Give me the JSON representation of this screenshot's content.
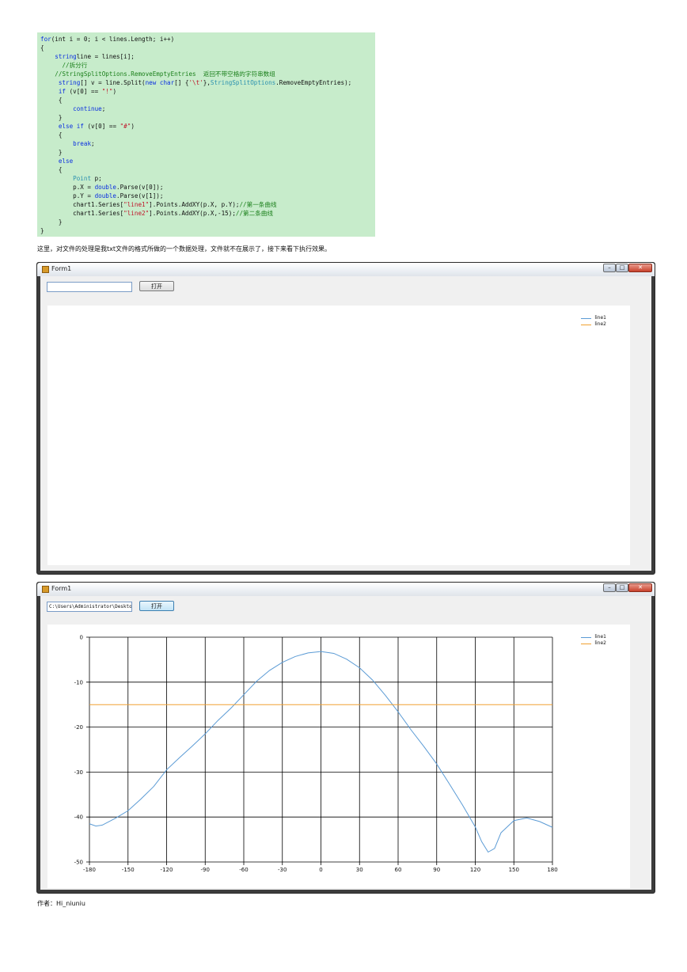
{
  "code": {
    "lines": [
      [
        [
          "kw",
          "for"
        ],
        [
          "",
          "(int i = 0; i < lines.Length; i++)"
        ]
      ],
      [
        [
          "",
          "{"
        ]
      ],
      [
        [
          "",
          "    "
        ],
        [
          "kw",
          "string"
        ],
        [
          "",
          "line = lines[i];"
        ]
      ],
      [
        [
          "",
          "      "
        ],
        [
          "cm",
          "//拆分行"
        ]
      ],
      [
        [
          "",
          "    "
        ],
        [
          "cm",
          "//StringSplitOptions.RemoveEmptyEntries  返回不带空格的字符串数组"
        ]
      ],
      [
        [
          "",
          "     "
        ],
        [
          "kw",
          "string"
        ],
        [
          "",
          "[] v = line.Split("
        ],
        [
          "kw",
          "new char"
        ],
        [
          "",
          "[] {"
        ],
        [
          "st",
          "'\\t'"
        ],
        [
          "",
          "},"
        ],
        [
          "ty",
          "StringSplitOptions"
        ],
        [
          "",
          ".RemoveEmptyEntries);"
        ]
      ],
      [
        [
          "",
          "     "
        ],
        [
          "kw",
          "if"
        ],
        [
          "",
          " (v[0] == "
        ],
        [
          "st",
          "\"!\""
        ],
        [
          "",
          ")"
        ]
      ],
      [
        [
          "",
          "     {"
        ]
      ],
      [
        [
          "",
          "         "
        ],
        [
          "kw",
          "continue"
        ],
        [
          "",
          ";"
        ]
      ],
      [
        [
          "",
          "     }"
        ]
      ],
      [
        [
          "",
          "     "
        ],
        [
          "kw",
          "else if"
        ],
        [
          "",
          " (v[0] == "
        ],
        [
          "st",
          "\"#\""
        ],
        [
          "",
          ")"
        ]
      ],
      [
        [
          "",
          "     {"
        ]
      ],
      [
        [
          "",
          "         "
        ],
        [
          "kw",
          "break"
        ],
        [
          "",
          ";"
        ]
      ],
      [
        [
          "",
          "     }"
        ]
      ],
      [
        [
          "",
          "     "
        ],
        [
          "kw",
          "else"
        ]
      ],
      [
        [
          "",
          "     {"
        ]
      ],
      [
        [
          "",
          "         "
        ],
        [
          "ty",
          "Point"
        ],
        [
          "",
          " p;"
        ]
      ],
      [
        [
          "",
          "         p.X = "
        ],
        [
          "kw",
          "double"
        ],
        [
          "",
          ".Parse(v[0]);"
        ]
      ],
      [
        [
          "",
          "         p.Y = "
        ],
        [
          "kw",
          "double"
        ],
        [
          "",
          ".Parse(v[1]);"
        ]
      ],
      [
        [
          "",
          "         chart1.Series["
        ],
        [
          "st",
          "\"line1\""
        ],
        [
          "",
          "].Points.AddXY(p.X, p.Y);"
        ],
        [
          "cm",
          "//第一条曲线"
        ]
      ],
      [
        [
          "",
          "         chart1.Series["
        ],
        [
          "st",
          "\"line2\""
        ],
        [
          "",
          "].Points.AddXY(p.X,-15);"
        ],
        [
          "cm",
          "//第二条曲线"
        ]
      ],
      [
        [
          "",
          "     }"
        ]
      ],
      [
        [
          "",
          "}"
        ]
      ]
    ]
  },
  "caption": "这里，对文件的处理是我txt文件的格式所做的一个数据处理，文件就不在展示了，接下来看下执行效果。",
  "author": "作者：Hi_niuniu",
  "window1": {
    "title": "Form1",
    "path_value": "",
    "open_label": "打开",
    "legend": [
      "line1",
      "line2"
    ]
  },
  "window2": {
    "title": "Form1",
    "path_value": "C:\\Users\\Administrator\\Deskto",
    "open_label": "打开",
    "legend": [
      "line1",
      "line2"
    ]
  },
  "colors": {
    "line1": "#5b9bd5",
    "line2": "#f0a030",
    "code_bg": "#c7eccb"
  },
  "chart_data": {
    "type": "line",
    "x_ticks": [
      -180,
      -150,
      -120,
      -90,
      -60,
      -30,
      0,
      30,
      60,
      90,
      120,
      150,
      180
    ],
    "y_ticks": [
      0,
      -10,
      -20,
      -30,
      -40,
      -50
    ],
    "xlim": [
      -180,
      180
    ],
    "ylim": [
      -50,
      0
    ],
    "grid": true,
    "legend_position": "top-right",
    "series": [
      {
        "name": "line1",
        "x": [
          -180,
          -175,
          -170,
          -160,
          -150,
          -140,
          -130,
          -120,
          -110,
          -100,
          -90,
          -80,
          -70,
          -60,
          -50,
          -40,
          -30,
          -20,
          -10,
          0,
          10,
          20,
          30,
          40,
          50,
          60,
          70,
          80,
          90,
          100,
          110,
          120,
          125,
          130,
          135,
          140,
          150,
          160,
          170,
          180
        ],
        "y": [
          -41.5,
          -42.0,
          -41.8,
          -40.3,
          -38.6,
          -36.0,
          -33.2,
          -29.5,
          -26.8,
          -24.2,
          -21.5,
          -18.5,
          -15.8,
          -12.8,
          -9.8,
          -7.4,
          -5.6,
          -4.3,
          -3.5,
          -3.2,
          -3.6,
          -4.9,
          -6.8,
          -9.5,
          -12.9,
          -16.6,
          -20.6,
          -24.3,
          -28.2,
          -32.7,
          -37.3,
          -42.2,
          -45.5,
          -47.8,
          -47.0,
          -43.5,
          -40.8,
          -40.2,
          -41.0,
          -42.3
        ]
      },
      {
        "name": "line2",
        "x": [
          -180,
          180
        ],
        "y": [
          -15,
          -15
        ]
      }
    ]
  }
}
